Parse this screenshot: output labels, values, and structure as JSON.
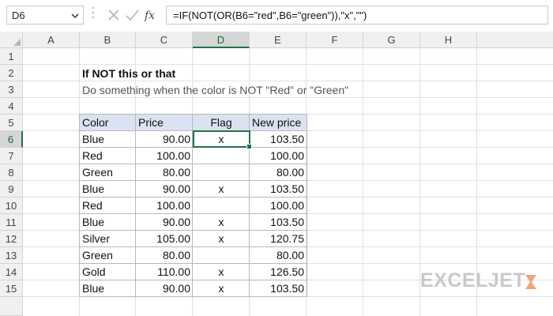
{
  "formula_bar": {
    "name_box": "D6",
    "formula": "=IF(NOT(OR(B6=\"red\",B6=\"green\")),\"x\",\"\")",
    "icons": [
      "chevron-down-icon",
      "cancel-icon",
      "enter-check-icon",
      "fx-icon"
    ]
  },
  "columns": [
    "A",
    "B",
    "C",
    "D",
    "E",
    "F",
    "G",
    "H"
  ],
  "selected_column": "D",
  "rows": [
    "1",
    "2",
    "3",
    "4",
    "5",
    "6",
    "7",
    "8",
    "9",
    "10",
    "11",
    "12",
    "13",
    "14",
    "15"
  ],
  "selected_row": "6",
  "sheet": {
    "title": "If NOT this or that",
    "subtitle": "Do something when the color is NOT \"Red\" or \"Green\""
  },
  "table": {
    "headers": {
      "color": "Color",
      "price": "Price",
      "flag": "Flag",
      "new_price": "New price"
    },
    "rows": [
      {
        "color": "Blue",
        "price": "90.00",
        "flag": "x",
        "new_price": "103.50"
      },
      {
        "color": "Red",
        "price": "100.00",
        "flag": "",
        "new_price": "100.00"
      },
      {
        "color": "Green",
        "price": "80.00",
        "flag": "",
        "new_price": "80.00"
      },
      {
        "color": "Blue",
        "price": "90.00",
        "flag": "x",
        "new_price": "103.50"
      },
      {
        "color": "Red",
        "price": "100.00",
        "flag": "",
        "new_price": "100.00"
      },
      {
        "color": "Blue",
        "price": "90.00",
        "flag": "x",
        "new_price": "103.50"
      },
      {
        "color": "Silver",
        "price": "105.00",
        "flag": "x",
        "new_price": "120.75"
      },
      {
        "color": "Green",
        "price": "80.00",
        "flag": "",
        "new_price": "80.00"
      },
      {
        "color": "Gold",
        "price": "110.00",
        "flag": "x",
        "new_price": "126.50"
      },
      {
        "color": "Blue",
        "price": "90.00",
        "flag": "x",
        "new_price": "103.50"
      }
    ]
  },
  "brand": {
    "logo_text": "EXCELJET",
    "accent": "#217346",
    "header_fill": "#dbe2f1"
  }
}
